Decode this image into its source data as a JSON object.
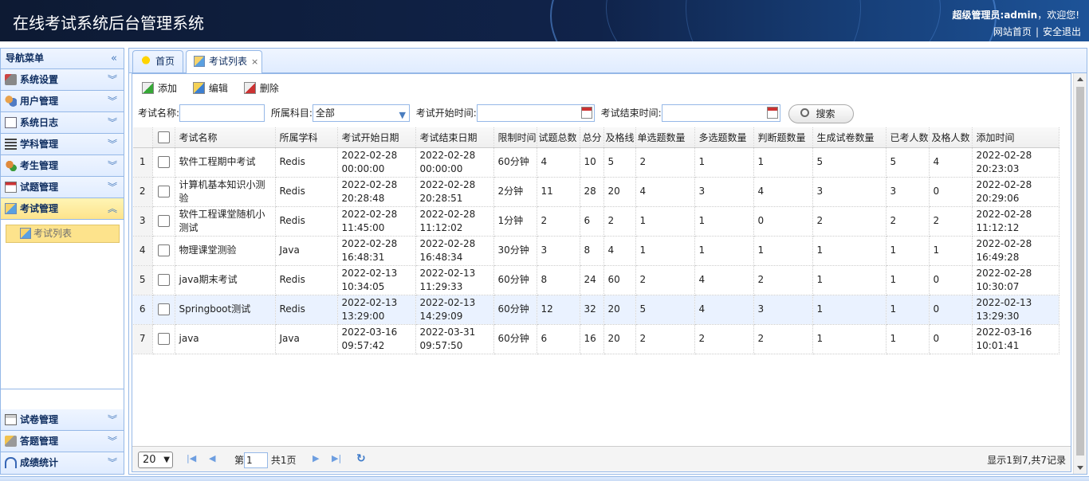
{
  "header": {
    "title": "在线考试系统后台管理系统",
    "welcome_user": "超级管理员:admin",
    "welcome_suffix": "，欢迎您!",
    "link_home": "网站首页",
    "link_separator": "|",
    "link_logout": "安全退出"
  },
  "sidebar": {
    "title": "导航菜单",
    "collapse_glyph": "«",
    "items": [
      {
        "label": "系统设置",
        "icon": "wrench-icon"
      },
      {
        "label": "用户管理",
        "icon": "users-icon"
      },
      {
        "label": "系统日志",
        "icon": "log-icon"
      },
      {
        "label": "学科管理",
        "icon": "list-icon"
      },
      {
        "label": "考生管理",
        "icon": "student-icon"
      },
      {
        "label": "试题管理",
        "icon": "calendar-icon"
      },
      {
        "label": "考试管理",
        "icon": "exam-icon"
      }
    ],
    "active_sub_item": "考试列表",
    "bottom_items": [
      {
        "label": "试卷管理",
        "icon": "paper-icon"
      },
      {
        "label": "答题管理",
        "icon": "answer-icon"
      },
      {
        "label": "成绩统计",
        "icon": "headphone-icon"
      }
    ]
  },
  "tabs": [
    {
      "label": "首页",
      "icon": "bulb-icon",
      "active": false
    },
    {
      "label": "考试列表",
      "icon": "exam-icon",
      "active": true,
      "close": "×"
    }
  ],
  "toolbar": {
    "add_label": "添加",
    "edit_label": "编辑",
    "delete_label": "删除"
  },
  "search": {
    "name_label": "考试名称:",
    "name_value": "",
    "subject_label": "所属科目:",
    "subject_value": "全部",
    "start_label": "考试开始时间:",
    "start_value": "",
    "end_label": "考试结束时间:",
    "end_value": "",
    "button_label": "搜索"
  },
  "table": {
    "columns": [
      "考试名称",
      "所属学科",
      "考试开始日期",
      "考试结束日期",
      "限制时间",
      "试题总数",
      "总分",
      "及格线",
      "单选题数量",
      "多选题数量",
      "判断题数量",
      "生成试卷数量",
      "已考人数",
      "及格人数",
      "添加时间"
    ],
    "rows": [
      {
        "no": "1",
        "name": "软件工程期中考试",
        "subject": "Redis",
        "start": "2022-02-28 00:00:00",
        "end": "2022-02-28 00:00:00",
        "limit": "60分钟",
        "total": "4",
        "score": "10",
        "pass": "5",
        "single": "2",
        "multi": "1",
        "judge": "1",
        "papers": "5",
        "taken": "5",
        "passed": "4",
        "added": "2022-02-28 20:23:03"
      },
      {
        "no": "2",
        "name": "计算机基本知识小测验",
        "subject": "Redis",
        "start": "2022-02-28 20:28:48",
        "end": "2022-02-28 20:28:51",
        "limit": "2分钟",
        "total": "11",
        "score": "28",
        "pass": "20",
        "single": "4",
        "multi": "3",
        "judge": "4",
        "papers": "3",
        "taken": "3",
        "passed": "0",
        "added": "2022-02-28 20:29:06"
      },
      {
        "no": "3",
        "name": "软件工程课堂随机小测试",
        "subject": "Redis",
        "start": "2022-02-28 11:45:00",
        "end": "2022-02-28 11:12:02",
        "limit": "1分钟",
        "total": "2",
        "score": "6",
        "pass": "2",
        "single": "1",
        "multi": "1",
        "judge": "0",
        "papers": "2",
        "taken": "2",
        "passed": "2",
        "added": "2022-02-28 11:12:12"
      },
      {
        "no": "4",
        "name": "物理课堂测验",
        "subject": "Java",
        "start": "2022-02-28 16:48:31",
        "end": "2022-02-28 16:48:34",
        "limit": "30分钟",
        "total": "3",
        "score": "8",
        "pass": "4",
        "single": "1",
        "multi": "1",
        "judge": "1",
        "papers": "1",
        "taken": "1",
        "passed": "1",
        "added": "2022-02-28 16:49:28"
      },
      {
        "no": "5",
        "name": "java期末考试",
        "subject": "Redis",
        "start": "2022-02-13 10:34:05",
        "end": "2022-02-13 11:29:33",
        "limit": "60分钟",
        "total": "8",
        "score": "24",
        "pass": "60",
        "single": "2",
        "multi": "4",
        "judge": "2",
        "papers": "1",
        "taken": "1",
        "passed": "0",
        "added": "2022-02-28 10:30:07"
      },
      {
        "no": "6",
        "name": "Springboot测试",
        "subject": "Redis",
        "start": "2022-02-13 13:29:00",
        "end": "2022-02-13 14:29:09",
        "limit": "60分钟",
        "total": "12",
        "score": "32",
        "pass": "20",
        "single": "5",
        "multi": "4",
        "judge": "3",
        "papers": "1",
        "taken": "1",
        "passed": "0",
        "added": "2022-02-13 13:29:30"
      },
      {
        "no": "7",
        "name": "java",
        "subject": "Java",
        "start": "2022-03-16 09:57:42",
        "end": "2022-03-31 09:57:50",
        "limit": "60分钟",
        "total": "6",
        "score": "16",
        "pass": "20",
        "single": "2",
        "multi": "2",
        "judge": "2",
        "papers": "1",
        "taken": "1",
        "passed": "0",
        "added": "2022-03-16 10:01:41"
      }
    ]
  },
  "pager": {
    "page_size": "20",
    "page_prefix": "第",
    "page_value": "1",
    "page_suffix": "共1页",
    "info": "显示1到7,共7记录"
  }
}
